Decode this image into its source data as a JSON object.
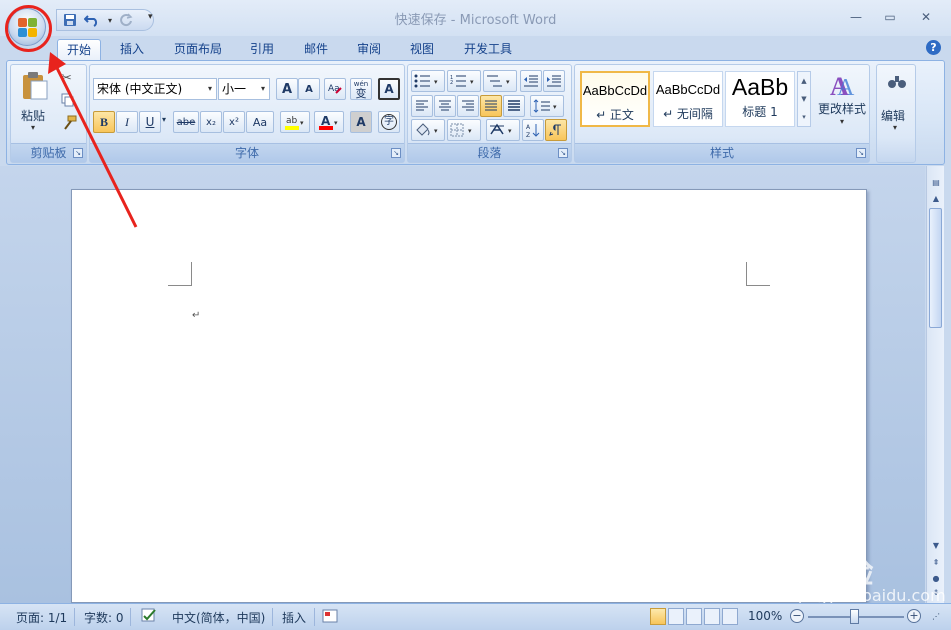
{
  "window": {
    "title": "快速保存 - Microsoft Word",
    "minimize_glyph": "—",
    "maximize_glyph": "▭",
    "close_glyph": "✕"
  },
  "qat": {
    "save_icon": "save-icon",
    "undo_icon": "undo-icon",
    "redo_icon": "redo-icon",
    "customize_glyph": "▾"
  },
  "tabs": [
    "开始",
    "插入",
    "页面布局",
    "引用",
    "邮件",
    "审阅",
    "视图",
    "开发工具"
  ],
  "active_tab": "开始",
  "help_glyph": "?",
  "ribbon": {
    "clipboard": {
      "label": "剪贴板",
      "paste_label": "粘贴"
    },
    "font": {
      "label": "字体",
      "font_name": "宋体 (中文正文)",
      "font_size": "小一",
      "grow_glyph": "A",
      "shrink_glyph": "A",
      "bold": "B",
      "italic": "I",
      "underline": "U",
      "strike": "abe",
      "subscript": "x₂",
      "superscript": "x²",
      "change_case": "Aa",
      "font_color_glyph": "A",
      "char_shading_glyph": "A",
      "enclose_glyph": "字",
      "wen_glyph": "wén",
      "bian_glyph": "变",
      "border_glyph": "A"
    },
    "paragraph": {
      "label": "段落"
    },
    "styles": {
      "label": "样式",
      "items": [
        {
          "sample": "AaBbCcDd",
          "name": "↵ 正文"
        },
        {
          "sample": "AaBbCcDd",
          "name": "↵ 无间隔"
        },
        {
          "sample": "AaBb",
          "name": "标题 1"
        }
      ],
      "change_styles": "更改样式"
    },
    "editing": {
      "label": "编辑"
    }
  },
  "document": {
    "paragraph_mark": "↵"
  },
  "status": {
    "page": "页面: 1/1",
    "words": "字数: 0",
    "language": "中文(简体，中国)",
    "mode": "插入",
    "zoom": "100%",
    "zoom_minus": "−",
    "zoom_plus": "+"
  },
  "watermark": {
    "text": "Baidu经验",
    "url": "jingyan.baidu.com"
  },
  "colors": {
    "annotation_red": "#e8231d",
    "ribbon_border": "#8db2e3",
    "active_button": "#f8c55a"
  }
}
